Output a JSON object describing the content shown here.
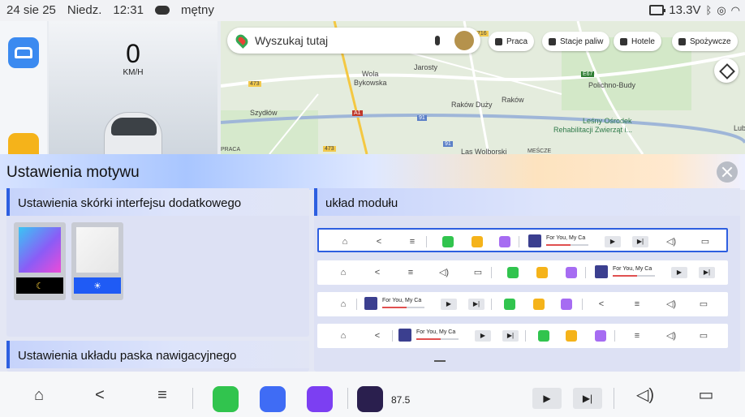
{
  "status_bar": {
    "date": "24 sie 25",
    "day": "Niedz.",
    "time": "12:31",
    "weather": "mętny",
    "voltage": "13.3V",
    "icons": [
      "cloud-icon",
      "battery-icon",
      "bluetooth-icon",
      "location-icon",
      "wifi-icon"
    ]
  },
  "dashboard": {
    "speed": "0",
    "speed_unit": "KM/H"
  },
  "map": {
    "search_placeholder": "Wyszukaj tutaj",
    "chips": [
      "Praca",
      "Stacje paliw",
      "Hotele",
      "Spożywcze"
    ],
    "labels": [
      "Jarosty",
      "Wola",
      "Bykowska",
      "Szydłów",
      "Raków Duży",
      "Raków",
      "Polichno-Budy",
      "Leśny Ośrodek",
      "Rehabilitacji Zwierząt i...",
      "Las Wolborski",
      "PRACA",
      "MEŚCZE",
      "Lub"
    ],
    "road_numbers": [
      "716",
      "473",
      "A1",
      "E67",
      "473",
      "91",
      "91"
    ]
  },
  "settings": {
    "title": "Ustawienia motywu",
    "skin_panel_title": "Ustawienia skórki interfejsu dodatkowego",
    "nav_layout_title": "Ustawienia układu paska nawigacyjnego",
    "module_panel_title": "układ modułu",
    "theme_options": [
      {
        "name": "dark",
        "icon": "moon-icon",
        "glyph": "☾",
        "colors": [
          "#39c6f4",
          "#8b5cf6",
          "#ec4bd8"
        ]
      },
      {
        "name": "light",
        "icon": "sun-icon",
        "glyph": "☀",
        "colors": [
          "#f7f7f7",
          "#e6e6e6"
        ]
      }
    ],
    "song_label": "For You,  My Ca"
  },
  "bottom_bar": {
    "radio_freq": "87.5",
    "icons": [
      "home-icon",
      "back-icon",
      "menu-icon",
      "phone-app-icon",
      "music-app-icon",
      "bluetooth-music-app-icon",
      "radio-app-icon",
      "play-icon",
      "next-icon",
      "volume-icon",
      "screen-icon"
    ]
  },
  "colors": {
    "accent": "#2e5fe0",
    "phone_app": "#31c44e",
    "music_app": "#3f6cf5",
    "bt_app": "#7c3ff2"
  }
}
